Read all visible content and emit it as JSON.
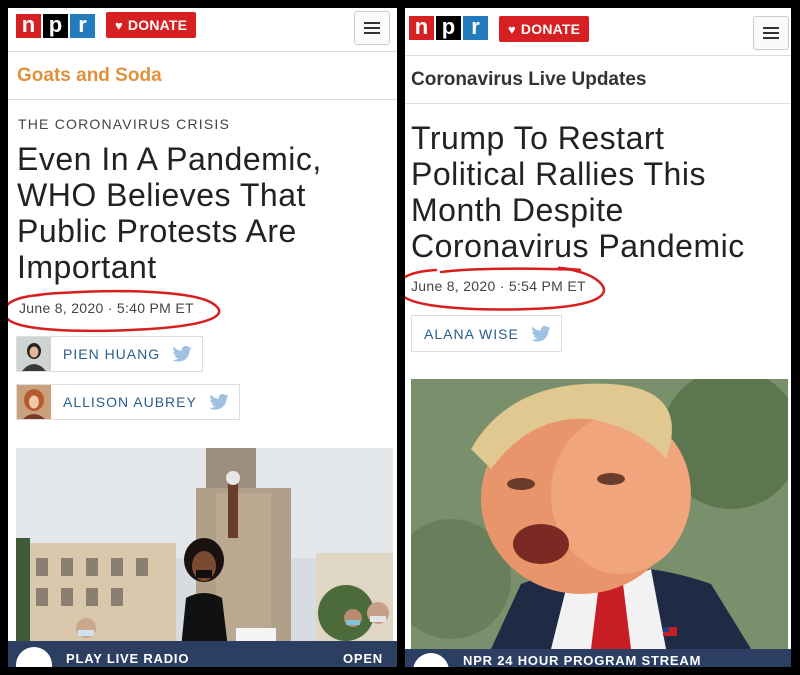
{
  "left": {
    "logo": [
      "n",
      "p",
      "r"
    ],
    "donate_label": "DONATE",
    "section_title": "Goats and Soda",
    "kicker": "THE CORONAVIRUS CRISIS",
    "headline": "Even In A Pandemic, WHO Believes That Public Protests Are Important",
    "date": "June 8, 2020 · 5:40 PM ET",
    "authors": [
      {
        "name": "PIEN HUANG",
        "icon": "twitter-icon"
      },
      {
        "name": "ALLISON AUBREY",
        "icon": "twitter-icon"
      }
    ],
    "player": {
      "label": "PLAY LIVE RADIO",
      "open": "OPEN"
    }
  },
  "right": {
    "logo": [
      "n",
      "p",
      "r"
    ],
    "donate_label": "DONATE",
    "section_title": "Coronavirus Live Updates",
    "headline": "Trump To Restart Political Rallies This Month Despite Coronavirus Pandemic",
    "date": "June 8, 2020 · 5:54 PM ET",
    "authors": [
      {
        "name": "ALANA WISE",
        "icon": "twitter-icon"
      }
    ],
    "player": {
      "label": "NPR 24 HOUR PROGRAM STREAM"
    }
  },
  "colors": {
    "npr_red": "#d62021",
    "npr_black": "#000000",
    "npr_blue": "#237bbd",
    "section_orange": "#e0913b",
    "section_dark": "#333333",
    "author_link": "#2a5d8f",
    "annotation_red": "#d81e1e"
  }
}
